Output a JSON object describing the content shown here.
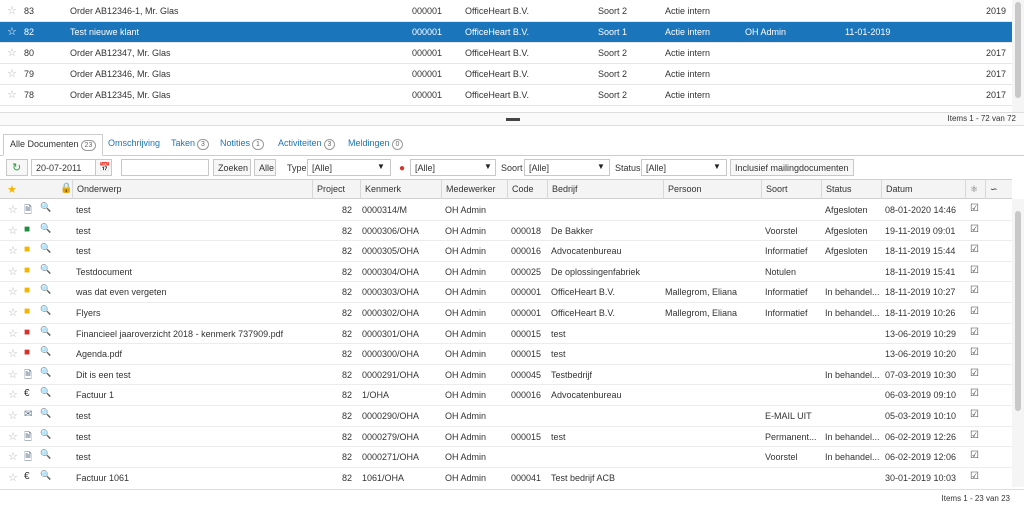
{
  "top_grid": {
    "rows": [
      {
        "nr": "83",
        "desc": "Order AB12346-1, Mr. Glas",
        "code": "000001",
        "company": "OfficeHeart B.V.",
        "sort": "Soort 2",
        "action": "Actie intern",
        "user": "",
        "date": "",
        "year": "2019",
        "selected": false
      },
      {
        "nr": "82",
        "desc": "Test nieuwe klant",
        "code": "000001",
        "company": "OfficeHeart B.V.",
        "sort": "Soort 1",
        "action": "Actie intern",
        "user": "OH Admin",
        "date": "11-01-2019",
        "year": "",
        "selected": true
      },
      {
        "nr": "80",
        "desc": "Order AB12347, Mr. Glas",
        "code": "000001",
        "company": "OfficeHeart B.V.",
        "sort": "Soort 2",
        "action": "Actie intern",
        "user": "",
        "date": "",
        "year": "2017",
        "selected": false
      },
      {
        "nr": "79",
        "desc": "Order AB12346, Mr. Glas",
        "code": "000001",
        "company": "OfficeHeart B.V.",
        "sort": "Soort 2",
        "action": "Actie intern",
        "user": "",
        "date": "",
        "year": "2017",
        "selected": false
      },
      {
        "nr": "78",
        "desc": "Order AB12345, Mr. Glas",
        "code": "000001",
        "company": "OfficeHeart B.V.",
        "sort": "Soort 2",
        "action": "Actie intern",
        "user": "",
        "date": "",
        "year": "2017",
        "selected": false
      }
    ],
    "pager": "Items 1 - 72 van 72"
  },
  "tabs": [
    {
      "label": "Alle Documenten",
      "count": "23",
      "active": true
    },
    {
      "label": "Omschrijving",
      "count": "",
      "active": false
    },
    {
      "label": "Taken",
      "count": "3",
      "active": false
    },
    {
      "label": "Notities",
      "count": "1",
      "active": false
    },
    {
      "label": "Activiteiten",
      "count": "3",
      "active": false
    },
    {
      "label": "Meldingen",
      "count": "0",
      "active": false
    }
  ],
  "toolbar": {
    "date_value": "20-07-2011",
    "search_value": "",
    "search_button": "Zoeken",
    "all_button": "Alle",
    "type_label": "Type",
    "type_value": "[Alle]",
    "person_value": "[Alle]",
    "soort_label": "Soort",
    "soort_value": "[Alle]",
    "status_label": "Status",
    "status_value": "[Alle]",
    "mailing_button": "Inclusief mailingdocumenten"
  },
  "grid": {
    "headers": {
      "onderwerp": "Onderwerp",
      "project": "Project",
      "kenmerk": "Kenmerk",
      "medewerker": "Medewerker",
      "code": "Code",
      "bedrijf": "Bedrijf",
      "persoon": "Persoon",
      "soort": "Soort",
      "status": "Status",
      "datum": "Datum"
    },
    "rows": [
      {
        "icon": "doc",
        "subject": "test",
        "project": "82",
        "ref": "0000314/M",
        "employee": "OH Admin",
        "code": "",
        "company": "",
        "person": "",
        "sort": "",
        "status": "Afgesloten",
        "date": "08-01-2020 14:46"
      },
      {
        "icon": "excel",
        "subject": "test",
        "project": "82",
        "ref": "0000306/OHA",
        "employee": "OH Admin",
        "code": "000018",
        "company": "De Bakker",
        "person": "",
        "sort": "Voorstel",
        "status": "Afgesloten",
        "date": "19-11-2019 09:01"
      },
      {
        "icon": "folder",
        "subject": "test",
        "project": "82",
        "ref": "0000305/OHA",
        "employee": "OH Admin",
        "code": "000016",
        "company": "Advocatenbureau",
        "person": "",
        "sort": "Informatief",
        "status": "Afgesloten",
        "date": "18-11-2019 15:44"
      },
      {
        "icon": "folder",
        "subject": "Testdocument",
        "project": "82",
        "ref": "0000304/OHA",
        "employee": "OH Admin",
        "code": "000025",
        "company": "De oplossingenfabriek",
        "person": "",
        "sort": "Notulen",
        "status": "",
        "date": "18-11-2019 15:41"
      },
      {
        "icon": "folder",
        "subject": "was dat even vergeten",
        "project": "82",
        "ref": "0000303/OHA",
        "employee": "OH Admin",
        "code": "000001",
        "company": "OfficeHeart B.V.",
        "person": "Mallegrom, Eliana",
        "sort": "Informatief",
        "status": "In behandel...",
        "date": "18-11-2019 10:27"
      },
      {
        "icon": "folder",
        "subject": "Flyers",
        "project": "82",
        "ref": "0000302/OHA",
        "employee": "OH Admin",
        "code": "000001",
        "company": "OfficeHeart B.V.",
        "person": "Mallegrom, Eliana",
        "sort": "Informatief",
        "status": "In behandel...",
        "date": "18-11-2019 10:26"
      },
      {
        "icon": "pdf",
        "subject": "Financieel jaaroverzicht 2018 - kenmerk 737909.pdf",
        "project": "82",
        "ref": "0000301/OHA",
        "employee": "OH Admin",
        "code": "000015",
        "company": "test",
        "person": "",
        "sort": "",
        "status": "",
        "date": "13-06-2019 10:29"
      },
      {
        "icon": "pdf",
        "subject": "Agenda.pdf",
        "project": "82",
        "ref": "0000300/OHA",
        "employee": "OH Admin",
        "code": "000015",
        "company": "test",
        "person": "",
        "sort": "",
        "status": "",
        "date": "13-06-2019 10:20"
      },
      {
        "icon": "doc",
        "subject": "Dit is een test",
        "project": "82",
        "ref": "0000291/OHA",
        "employee": "OH Admin",
        "code": "000045",
        "company": "Testbedrijf",
        "person": "",
        "sort": "",
        "status": "In behandel...",
        "date": "07-03-2019 10:30"
      },
      {
        "icon": "euro",
        "subject": "Factuur 1",
        "project": "82",
        "ref": "1/OHA",
        "employee": "OH Admin",
        "code": "000016",
        "company": "Advocatenbureau",
        "person": "",
        "sort": "",
        "status": "",
        "date": "06-03-2019 09:10"
      },
      {
        "icon": "mail",
        "subject": "test",
        "project": "82",
        "ref": "0000290/OHA",
        "employee": "OH Admin",
        "code": "",
        "company": "",
        "person": "",
        "sort": "E-MAIL UIT",
        "status": "",
        "date": "05-03-2019 10:10"
      },
      {
        "icon": "doc",
        "subject": "test",
        "project": "82",
        "ref": "0000279/OHA",
        "employee": "OH Admin",
        "code": "000015",
        "company": "test",
        "person": "",
        "sort": "Permanent...",
        "status": "In behandel...",
        "date": "06-02-2019 12:26"
      },
      {
        "icon": "doc",
        "subject": "test",
        "project": "82",
        "ref": "0000271/OHA",
        "employee": "OH Admin",
        "code": "",
        "company": "",
        "person": "",
        "sort": "Voorstel",
        "status": "In behandel...",
        "date": "06-02-2019 12:06"
      },
      {
        "icon": "euro",
        "subject": "Factuur 1061",
        "project": "82",
        "ref": "1061/OHA",
        "employee": "OH Admin",
        "code": "000041",
        "company": "Test bedrijf ACB",
        "person": "",
        "sort": "",
        "status": "",
        "date": "30-01-2019 10:03"
      }
    ],
    "pager": "Items 1 - 23 van 23"
  },
  "colors": {
    "accent": "#1b75bb",
    "excel": "#1e8e3e",
    "pdf": "#d9322b",
    "folder": "#f4b400"
  }
}
